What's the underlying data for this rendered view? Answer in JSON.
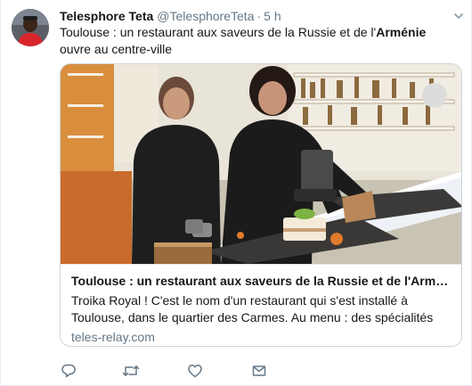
{
  "tweet": {
    "display_name": "Telesphore Teta",
    "handle": "@TelesphoreTeta",
    "separator": "·",
    "timestamp": "5 h",
    "text_before": "Toulouse : un restaurant aux saveurs de la Russie et de l'",
    "text_bold": "Arménie",
    "text_after": " ouvre au centre-ville"
  },
  "card": {
    "title": "Toulouse : un restaurant aux saveurs de la Russie et de l'Arméni...",
    "description": "Troika Royal ! C'est le nom d'un restaurant qui s'est installé à Toulouse, dans le quartier des Carmes. Au menu : des spécialités venues de",
    "domain": "teles-relay.com"
  },
  "actions": {
    "reply_icon": "reply-icon",
    "retweet_icon": "retweet-icon",
    "like_icon": "heart-icon",
    "dm_icon": "envelope-icon"
  },
  "colors": {
    "text": "#14171a",
    "secondary": "#657786",
    "border": "#e6ecf0",
    "card_border": "#ccd6dd"
  }
}
